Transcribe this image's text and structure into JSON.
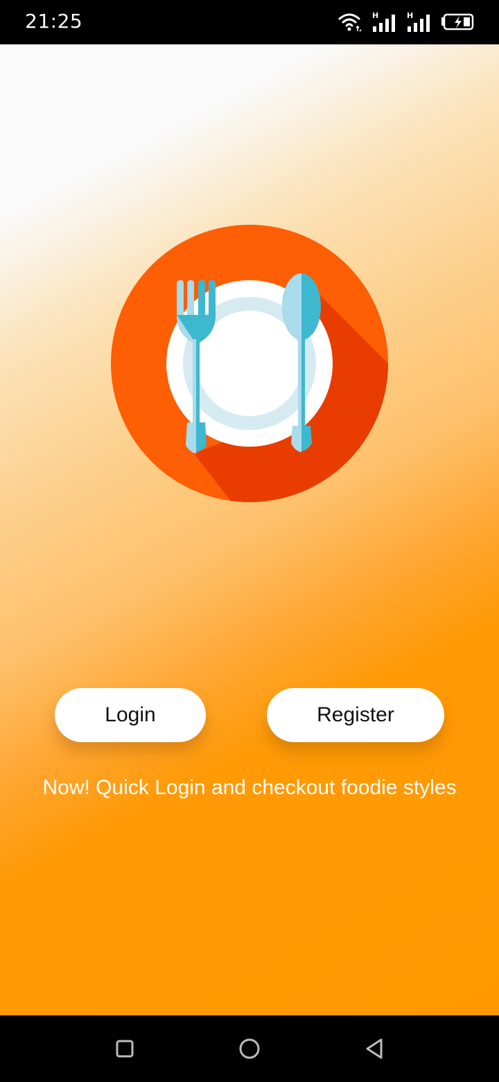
{
  "status_bar": {
    "time": "21:25",
    "icons": [
      "wifi-icon",
      "signal-h-icon",
      "signal-h-icon",
      "battery-charging-icon"
    ],
    "network_type": "H"
  },
  "app": {
    "logo_icon": "plate-fork-spoon-icon",
    "colors": {
      "primary_orange": "#ff9800",
      "logo_circle": "#fe5e04",
      "logo_shadow": "#e83c00",
      "utensil_blue": "#3db8cf"
    }
  },
  "actions": {
    "login_label": "Login",
    "register_label": "Register"
  },
  "tagline": "Now! Quick Login and checkout foodie styles",
  "nav_bar": {
    "icons": [
      "recent-apps-icon",
      "home-icon",
      "back-icon"
    ]
  }
}
